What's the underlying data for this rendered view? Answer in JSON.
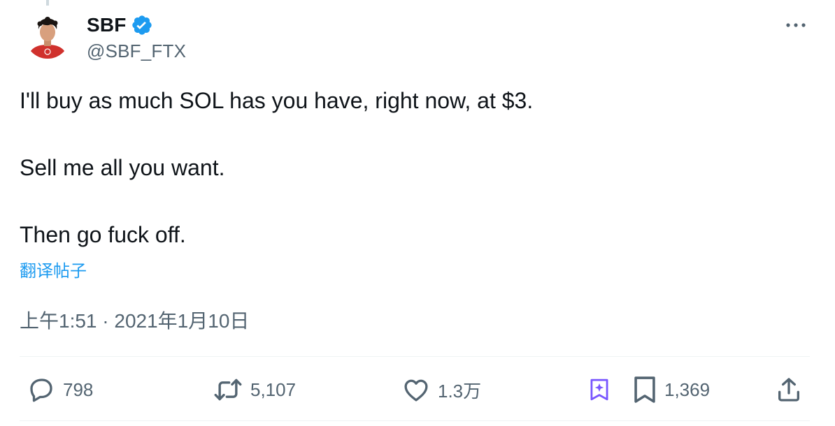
{
  "author": {
    "display_name": "SBF",
    "handle": "@SBF_FTX",
    "verified": true
  },
  "tweet": {
    "text": "I'll buy as much SOL has you have, right now, at $3.\n\nSell me all you want.\n\nThen go fuck off.",
    "translate_label": "翻译帖子",
    "timestamp": "上午1:51 · 2021年1月10日"
  },
  "actions": {
    "replies": "798",
    "retweets": "5,107",
    "likes": "1.3万",
    "bookmarks": "1,369"
  },
  "icons": {
    "verified": "verified-badge-icon",
    "more": "more-dots-icon",
    "reply": "reply-icon",
    "retweet": "retweet-icon",
    "like": "heart-icon",
    "grok": "grok-icon",
    "bookmark": "bookmark-icon",
    "share": "share-icon"
  },
  "colors": {
    "accent": "#1d9bf0",
    "secondary_text": "#536471",
    "grok": "#7856ff"
  }
}
